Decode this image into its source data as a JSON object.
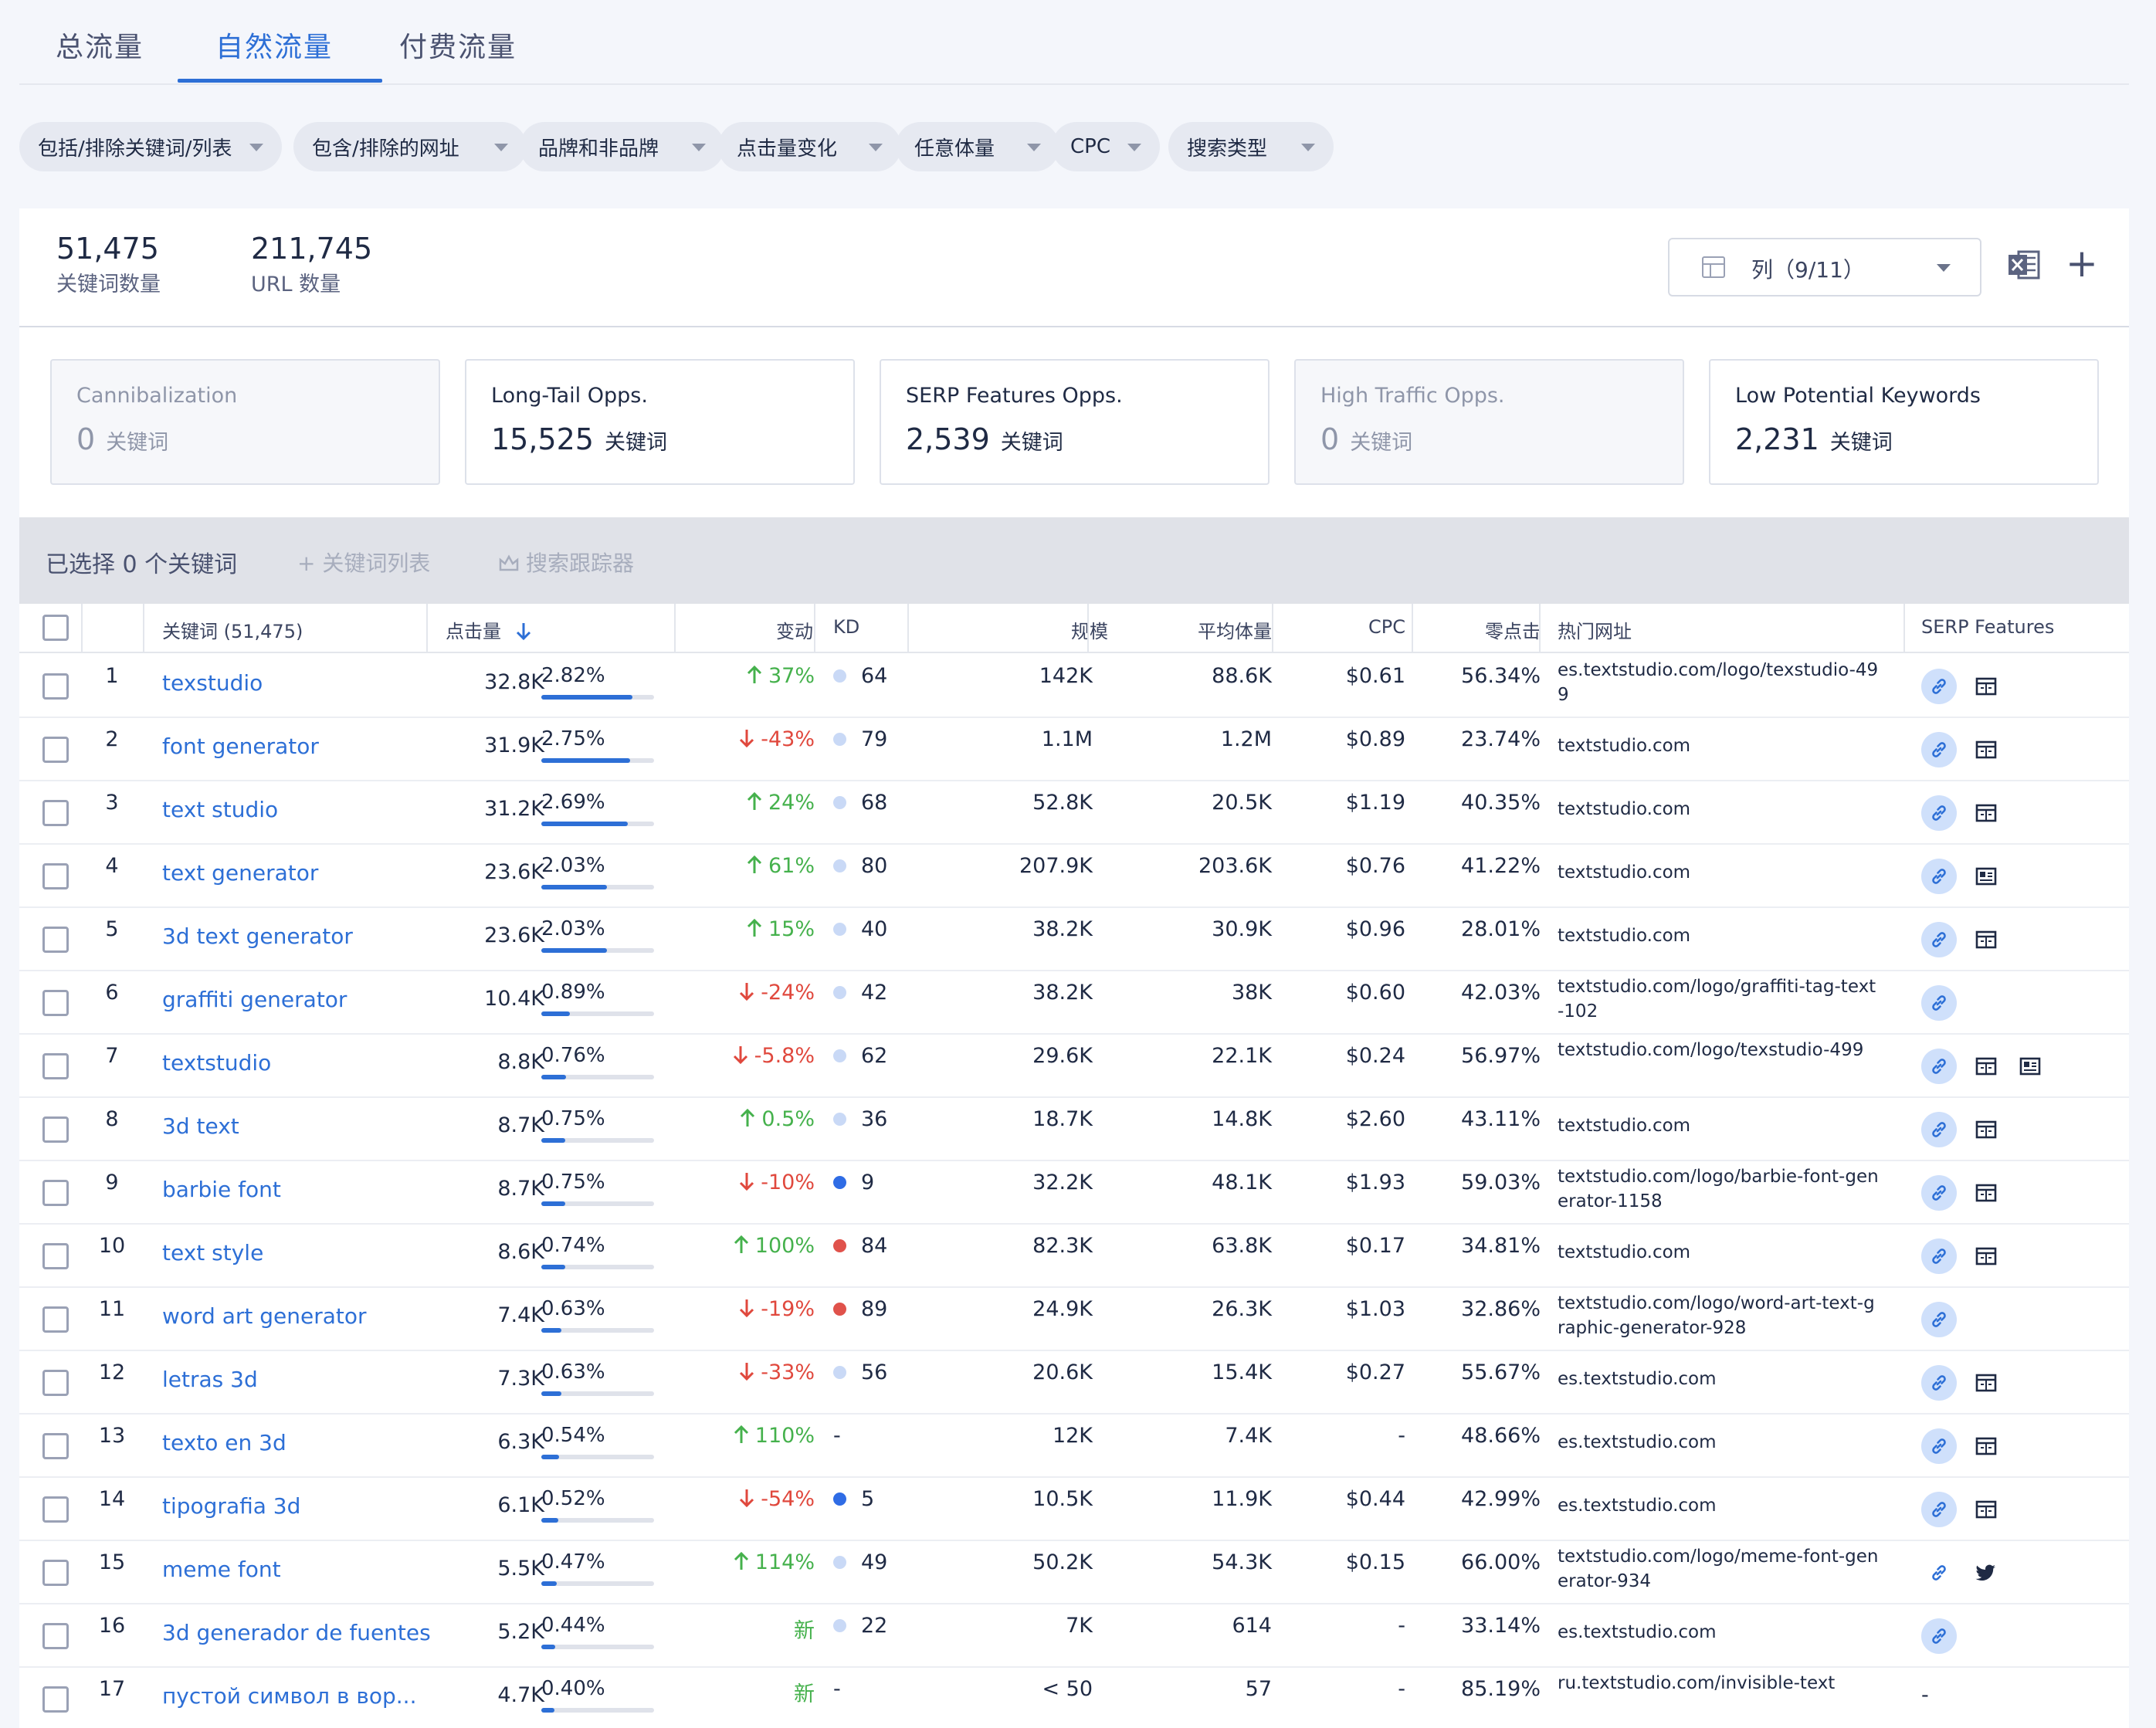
{
  "tabs": [
    {
      "label": "总流量",
      "active": false
    },
    {
      "label": "自然流量",
      "active": true
    },
    {
      "label": "付费流量",
      "active": false
    }
  ],
  "filters": [
    {
      "label": "包括/排除关键词/列表"
    },
    {
      "label": "包含/排除的网址"
    },
    {
      "label": "品牌和非品牌"
    },
    {
      "label": "点击量变化"
    },
    {
      "label": "任意体量"
    },
    {
      "label": "CPC"
    },
    {
      "label": "搜索类型"
    }
  ],
  "summary": {
    "keywords_count": "51,475",
    "keywords_label": "关键词数量",
    "urls_count": "211,745",
    "urls_label": "URL 数量",
    "columns_label": "列（9/11）"
  },
  "cards": [
    {
      "title": "Cannibalization",
      "value": "0",
      "unit": "关键词",
      "disabled": true
    },
    {
      "title": "Long-Tail Opps.",
      "value": "15,525",
      "unit": "关键词",
      "disabled": false
    },
    {
      "title": "SERP Features Opps.",
      "value": "2,539",
      "unit": "关键词",
      "disabled": false
    },
    {
      "title": "High Traffic Opps.",
      "value": "0",
      "unit": "关键词",
      "disabled": true
    },
    {
      "title": "Low Potential Keywords",
      "value": "2,231",
      "unit": "关键词",
      "disabled": false
    }
  ],
  "selection": {
    "selected_text": "已选择 0 个关键词",
    "add_list_label": "+ 关键词列表",
    "tracker_label": "搜索跟踪器"
  },
  "table": {
    "headers": {
      "keyword": "关键词 (51,475)",
      "clicks": "点击量",
      "change": "变动",
      "kd": "KD",
      "scale": "规模",
      "avg_volume": "平均体量",
      "cpc": "CPC",
      "zero_click": "零点击",
      "top_url": "热门网址",
      "serp": "SERP Features"
    },
    "colors": {
      "accent": "#2d6fd6",
      "up": "#45b14c",
      "down": "#e0483d",
      "kd_light": "#c9d9f6",
      "kd_blue": "#2f6ce5",
      "kd_red": "#e0524b"
    },
    "rows": [
      {
        "n": "1",
        "keyword": "texstudio",
        "clicks": "32.8K",
        "share": "2.82%",
        "share_val": 2.82,
        "dir": "up",
        "change": "37%",
        "kd_color": "light",
        "kd": "64",
        "scale": "142K",
        "avg": "88.6K",
        "cpc": "$0.61",
        "zero": "56.34%",
        "url": "es.textstudio.com/logo/texstudio-499",
        "serp_link": "circle",
        "serp_icons": [
          "sitelinks-icon"
        ]
      },
      {
        "n": "2",
        "keyword": "font generator",
        "clicks": "31.9K",
        "share": "2.75%",
        "share_val": 2.75,
        "dir": "down",
        "change": "-43%",
        "kd_color": "light",
        "kd": "79",
        "scale": "1.1M",
        "avg": "1.2M",
        "cpc": "$0.89",
        "zero": "23.74%",
        "url": "textstudio.com",
        "serp_link": "circle",
        "serp_icons": [
          "sitelinks-icon"
        ]
      },
      {
        "n": "3",
        "keyword": "text studio",
        "clicks": "31.2K",
        "share": "2.69%",
        "share_val": 2.69,
        "dir": "up",
        "change": "24%",
        "kd_color": "light",
        "kd": "68",
        "scale": "52.8K",
        "avg": "20.5K",
        "cpc": "$1.19",
        "zero": "40.35%",
        "url": "textstudio.com",
        "serp_link": "circle",
        "serp_icons": [
          "sitelinks-icon"
        ]
      },
      {
        "n": "4",
        "keyword": "text generator",
        "clicks": "23.6K",
        "share": "2.03%",
        "share_val": 2.03,
        "dir": "up",
        "change": "61%",
        "kd_color": "light",
        "kd": "80",
        "scale": "207.9K",
        "avg": "203.6K",
        "cpc": "$0.76",
        "zero": "41.22%",
        "url": "textstudio.com",
        "serp_link": "circle",
        "serp_icons": [
          "news-icon"
        ]
      },
      {
        "n": "5",
        "keyword": "3d text generator",
        "clicks": "23.6K",
        "share": "2.03%",
        "share_val": 2.03,
        "dir": "up",
        "change": "15%",
        "kd_color": "light",
        "kd": "40",
        "scale": "38.2K",
        "avg": "30.9K",
        "cpc": "$0.96",
        "zero": "28.01%",
        "url": "textstudio.com",
        "serp_link": "circle",
        "serp_icons": [
          "sitelinks-icon"
        ]
      },
      {
        "n": "6",
        "keyword": "graffiti generator",
        "clicks": "10.4K",
        "share": "0.89%",
        "share_val": 0.89,
        "dir": "down",
        "change": "-24%",
        "kd_color": "light",
        "kd": "42",
        "scale": "38.2K",
        "avg": "38K",
        "cpc": "$0.60",
        "zero": "42.03%",
        "url": "textstudio.com/logo/graffiti-tag-text-102",
        "serp_link": "circle",
        "serp_icons": []
      },
      {
        "n": "7",
        "keyword": "textstudio",
        "clicks": "8.8K",
        "share": "0.76%",
        "share_val": 0.76,
        "dir": "down",
        "change": "-5.8%",
        "kd_color": "light",
        "kd": "62",
        "scale": "29.6K",
        "avg": "22.1K",
        "cpc": "$0.24",
        "zero": "56.97%",
        "url": "textstudio.com/logo/texstudio-499",
        "serp_link": "circle",
        "serp_icons": [
          "sitelinks-icon",
          "news-icon"
        ]
      },
      {
        "n": "8",
        "keyword": "3d text",
        "clicks": "8.7K",
        "share": "0.75%",
        "share_val": 0.75,
        "dir": "up",
        "change": "0.5%",
        "kd_color": "light",
        "kd": "36",
        "scale": "18.7K",
        "avg": "14.8K",
        "cpc": "$2.60",
        "zero": "43.11%",
        "url": "textstudio.com",
        "serp_link": "circle",
        "serp_icons": [
          "sitelinks-icon"
        ]
      },
      {
        "n": "9",
        "keyword": "barbie font",
        "clicks": "8.7K",
        "share": "0.75%",
        "share_val": 0.75,
        "dir": "down",
        "change": "-10%",
        "kd_color": "blue",
        "kd": "9",
        "scale": "32.2K",
        "avg": "48.1K",
        "cpc": "$1.93",
        "zero": "59.03%",
        "url": "textstudio.com/logo/barbie-font-generator-1158",
        "serp_link": "circle",
        "serp_icons": [
          "sitelinks-icon"
        ]
      },
      {
        "n": "10",
        "keyword": "text style",
        "clicks": "8.6K",
        "share": "0.74%",
        "share_val": 0.74,
        "dir": "up",
        "change": "100%",
        "kd_color": "red",
        "kd": "84",
        "scale": "82.3K",
        "avg": "63.8K",
        "cpc": "$0.17",
        "zero": "34.81%",
        "url": "textstudio.com",
        "serp_link": "circle",
        "serp_icons": [
          "sitelinks-icon"
        ]
      },
      {
        "n": "11",
        "keyword": "word art generator",
        "clicks": "7.4K",
        "share": "0.63%",
        "share_val": 0.63,
        "dir": "down",
        "change": "-19%",
        "kd_color": "red",
        "kd": "89",
        "scale": "24.9K",
        "avg": "26.3K",
        "cpc": "$1.03",
        "zero": "32.86%",
        "url": "textstudio.com/logo/word-art-text-graphic-generator-928",
        "serp_link": "circle",
        "serp_icons": []
      },
      {
        "n": "12",
        "keyword": "letras 3d",
        "clicks": "7.3K",
        "share": "0.63%",
        "share_val": 0.63,
        "dir": "down",
        "change": "-33%",
        "kd_color": "light",
        "kd": "56",
        "scale": "20.6K",
        "avg": "15.4K",
        "cpc": "$0.27",
        "zero": "55.67%",
        "url": "es.textstudio.com",
        "serp_link": "circle",
        "serp_icons": [
          "sitelinks-icon"
        ]
      },
      {
        "n": "13",
        "keyword": "texto en 3d",
        "clicks": "6.3K",
        "share": "0.54%",
        "share_val": 0.54,
        "dir": "up",
        "change": "110%",
        "kd_color": "none",
        "kd": "-",
        "scale": "12K",
        "avg": "7.4K",
        "cpc": "-",
        "zero": "48.66%",
        "url": "es.textstudio.com",
        "serp_link": "circle",
        "serp_icons": [
          "sitelinks-icon"
        ]
      },
      {
        "n": "14",
        "keyword": "tipografia 3d",
        "clicks": "6.1K",
        "share": "0.52%",
        "share_val": 0.52,
        "dir": "down",
        "change": "-54%",
        "kd_color": "blue",
        "kd": "5",
        "scale": "10.5K",
        "avg": "11.9K",
        "cpc": "$0.44",
        "zero": "42.99%",
        "url": "es.textstudio.com",
        "serp_link": "circle",
        "serp_icons": [
          "sitelinks-icon"
        ]
      },
      {
        "n": "15",
        "keyword": "meme font",
        "clicks": "5.5K",
        "share": "0.47%",
        "share_val": 0.47,
        "dir": "up",
        "change": "114%",
        "kd_color": "light",
        "kd": "49",
        "scale": "50.2K",
        "avg": "54.3K",
        "cpc": "$0.15",
        "zero": "66.00%",
        "url": "textstudio.com/logo/meme-font-generator-934",
        "serp_link": "plain",
        "serp_icons": [
          "twitter-icon"
        ]
      },
      {
        "n": "16",
        "keyword": "3d generador de fuentes",
        "clicks": "5.2K",
        "share": "0.44%",
        "share_val": 0.44,
        "dir": "new",
        "change": "新",
        "kd_color": "light",
        "kd": "22",
        "scale": "7K",
        "avg": "614",
        "cpc": "-",
        "zero": "33.14%",
        "url": "es.textstudio.com",
        "serp_link": "circle",
        "serp_icons": []
      },
      {
        "n": "17",
        "keyword": "пустой символ в вор...",
        "clicks": "4.7K",
        "share": "0.40%",
        "share_val": 0.4,
        "dir": "new",
        "change": "新",
        "kd_color": "none",
        "kd": "-",
        "scale": "< 50",
        "avg": "57",
        "cpc": "-",
        "zero": "85.19%",
        "url": "ru.textstudio.com/invisible-text",
        "serp_link": "none",
        "serp_text": "-",
        "serp_icons": []
      }
    ]
  }
}
